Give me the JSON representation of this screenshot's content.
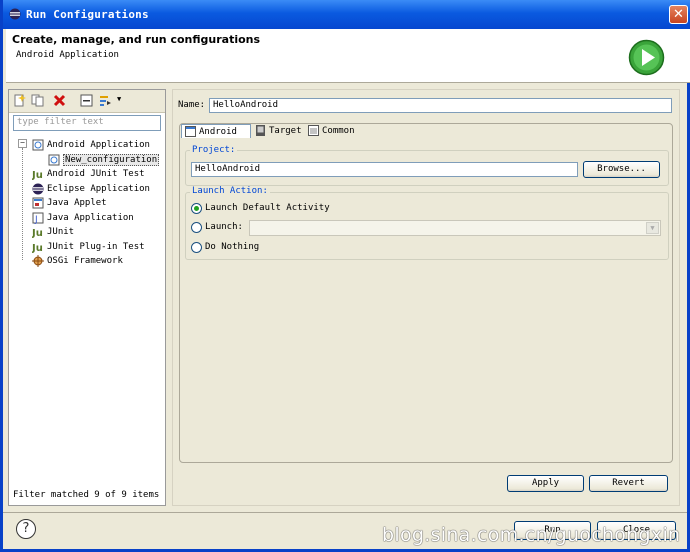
{
  "window": {
    "title": "Run Configurations",
    "close_glyph": "✕"
  },
  "header": {
    "title": "Create, manage, and run configurations",
    "subtitle": "Android Application"
  },
  "left": {
    "filter_placeholder": "type filter text",
    "tree": [
      {
        "label": "Android Application",
        "icon": "android-app-icon"
      },
      {
        "label": "New_configuration",
        "icon": "config-icon"
      },
      {
        "label": "Android JUnit Test",
        "icon": "junit-icon"
      },
      {
        "label": "Eclipse Application",
        "icon": "eclipse-icon"
      },
      {
        "label": "Java Applet",
        "icon": "applet-icon"
      },
      {
        "label": "Java Application",
        "icon": "java-app-icon"
      },
      {
        "label": "JUnit",
        "icon": "junit-icon"
      },
      {
        "label": "JUnit Plug-in Test",
        "icon": "junit-plugin-icon"
      },
      {
        "label": "OSGi Framework",
        "icon": "osgi-icon"
      }
    ],
    "filter_status": "Filter matched 9 of 9 items"
  },
  "right": {
    "name_label": "Name:",
    "name_value": "HelloAndroid",
    "tabs": [
      {
        "label": "Android",
        "icon": "android-tab-icon"
      },
      {
        "label": "Target",
        "icon": "target-icon"
      },
      {
        "label": "Common",
        "icon": "common-icon"
      }
    ],
    "project": {
      "label": "Project:",
      "value": "HelloAndroid",
      "browse": "Browse..."
    },
    "launch": {
      "label": "Launch Action:",
      "options": [
        {
          "label": "Launch Default Activity",
          "selected": true
        },
        {
          "label": "Launch:",
          "selected": false
        },
        {
          "label": "Do Nothing",
          "selected": false
        }
      ],
      "activity_value": ""
    },
    "apply": "Apply",
    "revert": "Revert"
  },
  "footer": {
    "run": "Run",
    "close": "Close",
    "help": "?"
  },
  "watermark": "blog.sina.com.cn/guochongxin"
}
